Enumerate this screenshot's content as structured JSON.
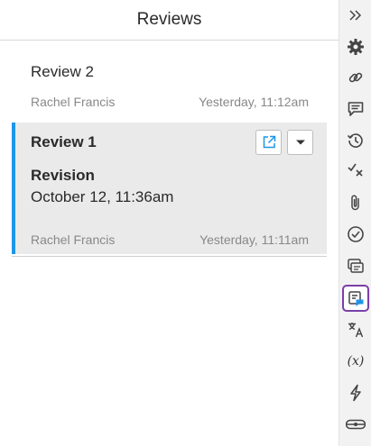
{
  "panel": {
    "title": "Reviews"
  },
  "reviews": [
    {
      "name": "Review 2",
      "author": "Rachel Francis",
      "time": "Yesterday, 11:12am"
    },
    {
      "name": "Review 1",
      "revision_label": "Revision",
      "revision_date": "October 12, 11:36am",
      "author": "Rachel Francis",
      "time": "Yesterday, 11:11am"
    }
  ],
  "toolbar": {
    "variable_text": "(x)",
    "icons": [
      "collapse-icon",
      "gear-icon",
      "link-icon",
      "comment-icon",
      "history-icon",
      "track-changes-icon",
      "attachment-icon",
      "check-circle-icon",
      "compare-icon",
      "reviews-icon",
      "translate-icon",
      "variables-icon",
      "lightning-icon",
      "integrations-icon"
    ]
  },
  "colors": {
    "accent": "#1e96e8",
    "active_outline": "#7a3fa8"
  }
}
